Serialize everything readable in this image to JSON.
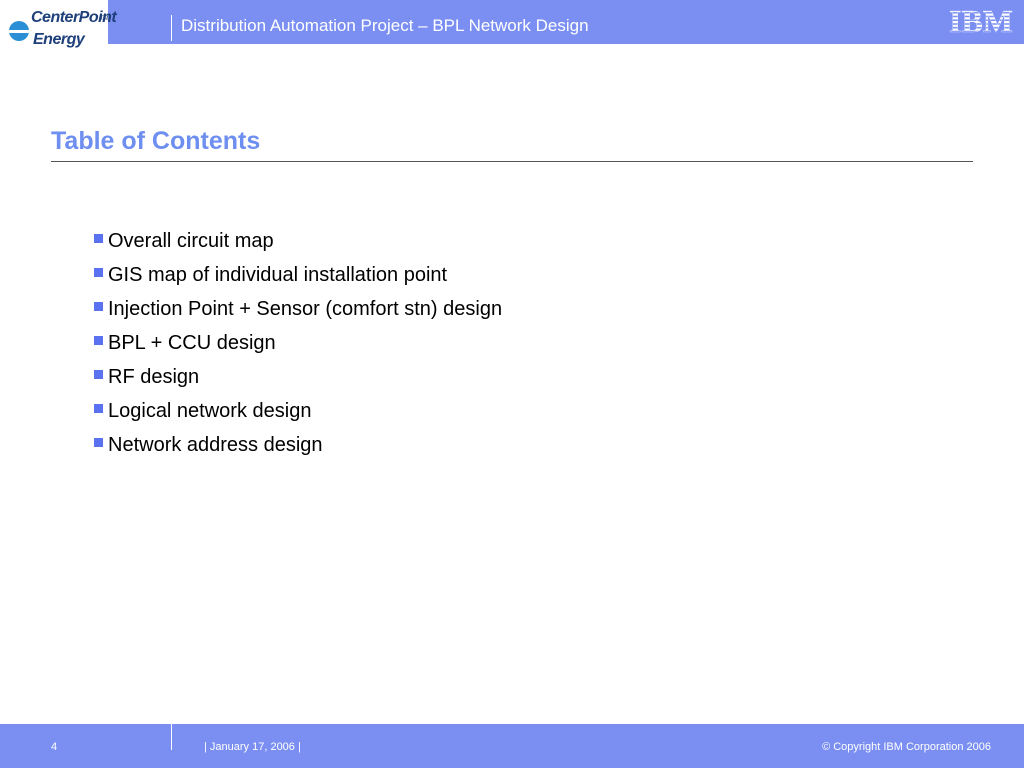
{
  "header": {
    "logo_line1": "CenterPoint",
    "logo_line2": "Energy",
    "logo_tm": "TM",
    "title": "Distribution Automation Project – BPL Network Design",
    "ibm_logo_text": "IBM"
  },
  "main": {
    "title": "Table of Contents",
    "items": [
      "Overall circuit map",
      "GIS map of individual installation point",
      "Injection Point + Sensor (comfort stn) design",
      "BPL + CCU design",
      "RF design",
      "Logical network design",
      "Network address design"
    ]
  },
  "footer": {
    "page_number": "4",
    "date": "|  January 17, 2006  |",
    "copyright": "© Copyright IBM Corporation 2006"
  },
  "colors": {
    "accent_bar": "#7b8ff2",
    "title_blue": "#6e8ef0",
    "bullet_blue": "#5b72f0"
  }
}
